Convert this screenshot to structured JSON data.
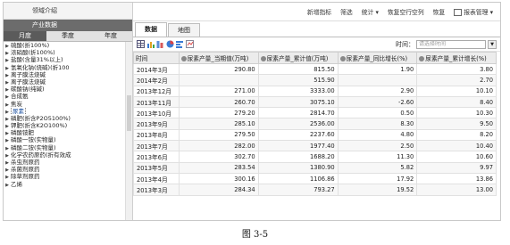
{
  "left": {
    "header1": "领域介绍",
    "header2": "产业数据",
    "period_tabs": [
      "月度",
      "季度",
      "年度"
    ],
    "tree": [
      {
        "label": "硫酸(折100%)",
        "arrow": "▶",
        "selected": false
      },
      {
        "label": "浓硝酸(折100%)",
        "arrow": "▶",
        "selected": false
      },
      {
        "label": "盐酸(含量31%以上)",
        "arrow": "▶",
        "selected": false
      },
      {
        "label": "氢氧化钠(烧碱)(折100",
        "arrow": "▶",
        "selected": false
      },
      {
        "label": "离子膜法烧碱",
        "arrow": "▶",
        "selected": false
      },
      {
        "label": "离子膜法烧碱",
        "arrow": "▶",
        "selected": false
      },
      {
        "label": "碳酸钠(纯碱)",
        "arrow": "▶",
        "selected": false
      },
      {
        "label": "合成氨",
        "arrow": "▶",
        "selected": false
      },
      {
        "label": "焦炭",
        "arrow": "▶",
        "selected": false
      },
      {
        "label": "尿素",
        "arrow": "▶",
        "selected": true
      },
      {
        "label": "磷肥(折含P2O5100%)",
        "arrow": "▶",
        "selected": false
      },
      {
        "label": "钾肥(折含K2O100%)",
        "arrow": "▶",
        "selected": false
      },
      {
        "label": "磷酸铵肥",
        "arrow": "▶",
        "selected": false
      },
      {
        "label": "磷酸一铵(实物量)",
        "arrow": "▶",
        "selected": false
      },
      {
        "label": "磷酸二铵(实物量)",
        "arrow": "▶",
        "selected": false
      },
      {
        "label": "化学农药原药(折有效成",
        "arrow": "▶",
        "selected": false
      },
      {
        "label": "杀虫剂原药",
        "arrow": "▶",
        "selected": false
      },
      {
        "label": "杀菌剂原药",
        "arrow": "▶",
        "selected": false
      },
      {
        "label": "除草剂原药",
        "arrow": "▶",
        "selected": false
      },
      {
        "label": "乙烯",
        "arrow": "▶",
        "selected": false
      }
    ]
  },
  "topbar": {
    "items": [
      "新增指标",
      "筛选",
      "统计 ▾",
      "恢复空行空列",
      "恢复",
      "报表管理 ▾"
    ]
  },
  "tabs": [
    "数据",
    "地图"
  ],
  "time": {
    "label": "时间：",
    "placeholder": "请选择时间"
  },
  "table": {
    "headers": [
      "时间",
      "尿素产量_当期值(万吨)",
      "尿素产量_累计值(万吨)",
      "尿素产量_同比增长(%)",
      "尿素产量_累计增长(%)"
    ],
    "rows": [
      [
        "2014年3月",
        "290.80",
        "815.50",
        "1.90",
        "3.80"
      ],
      [
        "2014年2月",
        "",
        "515.90",
        "",
        "2.70"
      ],
      [
        "2013年12月",
        "271.00",
        "3333.00",
        "2.90",
        "10.10"
      ],
      [
        "2013年11月",
        "260.70",
        "3075.10",
        "-2.60",
        "8.40"
      ],
      [
        "2013年10月",
        "279.20",
        "2814.70",
        "0.50",
        "10.30"
      ],
      [
        "2013年9月",
        "285.10",
        "2536.00",
        "8.30",
        "9.50"
      ],
      [
        "2013年8月",
        "279.50",
        "2237.60",
        "4.80",
        "8.20"
      ],
      [
        "2013年7月",
        "282.00",
        "1977.40",
        "2.50",
        "10.40"
      ],
      [
        "2013年6月",
        "302.70",
        "1688.20",
        "11.30",
        "10.60"
      ],
      [
        "2013年5月",
        "283.54",
        "1380.90",
        "5.82",
        "9.97"
      ],
      [
        "2013年4月",
        "300.16",
        "1106.86",
        "17.92",
        "13.86"
      ],
      [
        "2013年3月",
        "284.34",
        "793.27",
        "19.52",
        "13.00"
      ]
    ]
  },
  "caption": "图 3-5"
}
